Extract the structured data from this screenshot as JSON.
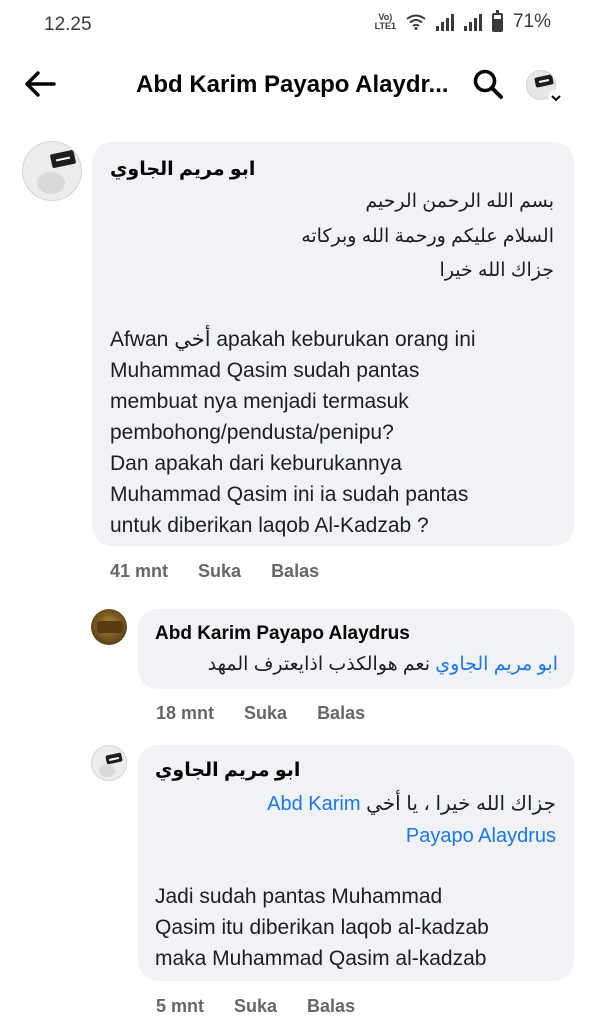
{
  "status_bar": {
    "time": "12.25",
    "volte": "Vo)\nLTE1",
    "battery_pct": "71%",
    "battery_level": 0.71
  },
  "header": {
    "title": "Abd Karim Payapo Alaydr..."
  },
  "comments": [
    {
      "author": "ابو مريم الجاوي",
      "arabic_lines": [
        "بسم الله الرحمن الرحيم",
        "السلام عليكم ورحمة الله وبركاته",
        "جزاك الله خيرا"
      ],
      "body_lines": [
        "Afwan أخي apakah keburukan orang ini",
        "Muhammad Qasim sudah pantas",
        "membuat nya menjadi termasuk",
        "pembohong/pendusta/penipu?",
        "Dan apakah dari keburukannya",
        "Muhammad Qasim ini ia sudah pantas",
        "untuk diberikan laqob Al-Kadzab ?"
      ],
      "time": "41 mnt",
      "like": "Suka",
      "reply": "Balas"
    },
    {
      "author": "Abd Karim Payapo Alaydrus",
      "mention": "ابو مريم الجاوي",
      "text": "نعم هوالكذب اذايعترف المهد",
      "time": "18 mnt",
      "like": "Suka",
      "reply": "Balas"
    },
    {
      "author": "ابو مريم الجاوي",
      "arabic_text": "جزاك الله خيرا ، يا أخي",
      "mention_line1": "Abd Karim",
      "mention_line2": "Payapo Alaydrus",
      "body_lines": [
        "Jadi sudah pantas Muhammad",
        "Qasim itu diberikan laqob al-kadzab",
        "maka Muhammad Qasim al-kadzab"
      ],
      "time": "5 mnt",
      "like": "Suka",
      "reply": "Balas"
    }
  ],
  "icons": {
    "back": "back-arrow-icon",
    "search": "search-icon",
    "profile": "profile-avatar-icon",
    "wifi": "wifi-icon",
    "signal": "signal-icon",
    "battery": "battery-icon"
  },
  "colors": {
    "bubble": "#f0f2f5",
    "link": "#1877f2",
    "meta": "#65676b"
  }
}
